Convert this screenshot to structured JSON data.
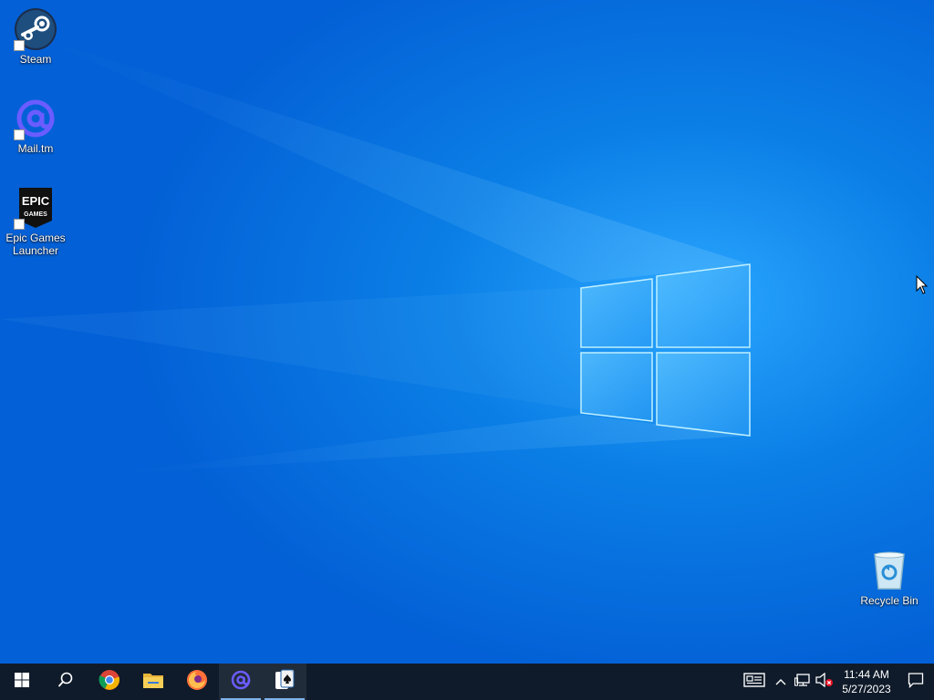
{
  "desktop": {
    "icons": [
      {
        "label": "Steam",
        "icon": "steam-icon"
      },
      {
        "label": "Mail.tm",
        "icon": "mail-at-icon"
      },
      {
        "label": "Epic Games Launcher",
        "icon": "epic-games-icon",
        "logo_text": "EPIC GAMES"
      },
      {
        "label": "Recycle Bin",
        "icon": "recycle-bin-icon"
      }
    ]
  },
  "taskbar": {
    "pinned": [
      {
        "name": "start",
        "icon": "windows-logo-icon"
      },
      {
        "name": "search",
        "icon": "search-icon"
      },
      {
        "name": "chrome",
        "icon": "chrome-icon"
      },
      {
        "name": "file-explorer",
        "icon": "folder-icon"
      },
      {
        "name": "firefox",
        "icon": "firefox-icon"
      },
      {
        "name": "mail-tm",
        "icon": "mail-at-icon",
        "active": true
      },
      {
        "name": "solitaire",
        "icon": "solitaire-icon",
        "active": true
      }
    ],
    "tray": {
      "icons": [
        "news-widget-icon",
        "chevron-up-icon",
        "network-icon",
        "volume-muted-icon",
        "notification-icon"
      ],
      "time": "11:44 AM",
      "date": "5/27/2023"
    }
  },
  "colors": {
    "taskbar_bg": "#0f1b2a",
    "desktop_accent": "#0b7fe6",
    "mail_purple": "#6b5cff"
  }
}
